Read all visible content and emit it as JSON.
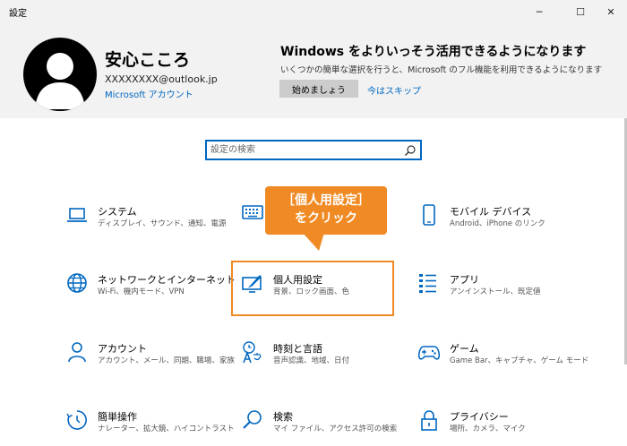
{
  "window": {
    "title": "設定",
    "minimize_glyph": "─",
    "maximize_glyph": "☐",
    "close_glyph": "✕"
  },
  "header": {
    "user_name": "安心こころ",
    "email": "XXXXXXXX@outlook.jp",
    "account_link": "Microsoft アカウント",
    "promo_title": "Windows をよりいっそう活用できるようになります",
    "promo_desc": "いくつかの簡単な選択を行うと、Microsoft のフル機能を利用できるようになります",
    "start_button": "始めましょう",
    "skip_link": "今はスキップ"
  },
  "search": {
    "placeholder": "設定の検索"
  },
  "callout": {
    "line1": "［個人用設定］",
    "line2": "をクリック"
  },
  "tiles": [
    {
      "title": "システム",
      "desc": "ディスプレイ、サウンド、通知、電源",
      "icon": "laptop-icon"
    },
    {
      "title": "",
      "desc": "",
      "icon": "keyboard-icon"
    },
    {
      "title": "モバイル デバイス",
      "desc": "Android、iPhone のリンク",
      "icon": "phone-icon"
    },
    {
      "title": "ネットワークとインターネット",
      "desc": "Wi-Fi、機内モード、VPN",
      "icon": "globe-icon"
    },
    {
      "title": "個人用設定",
      "desc": "背景、ロック画面、色",
      "icon": "personalization-icon"
    },
    {
      "title": "アプリ",
      "desc": "アンインストール、既定値",
      "icon": "apps-list-icon"
    },
    {
      "title": "アカウント",
      "desc": "アカウント、メール、同期、職場、家族",
      "icon": "person-icon"
    },
    {
      "title": "時刻と言語",
      "desc": "音声認識、地域、日付",
      "icon": "time-language-icon"
    },
    {
      "title": "ゲーム",
      "desc": "Game Bar、キャプチャ、ゲーム モード",
      "icon": "gamepad-icon"
    },
    {
      "title": "簡単操作",
      "desc": "ナレーター、拡大鏡、ハイコントラスト",
      "icon": "ease-of-access-icon"
    },
    {
      "title": "検索",
      "desc": "マイ ファイル、アクセス許可の検索",
      "icon": "search-icon"
    },
    {
      "title": "プライバシー",
      "desc": "場所、カメラ、マイク",
      "icon": "lock-icon"
    }
  ],
  "colors": {
    "accent": "#0067c0",
    "callout": "#f08a24",
    "header_bg": "#f2f2f2"
  }
}
